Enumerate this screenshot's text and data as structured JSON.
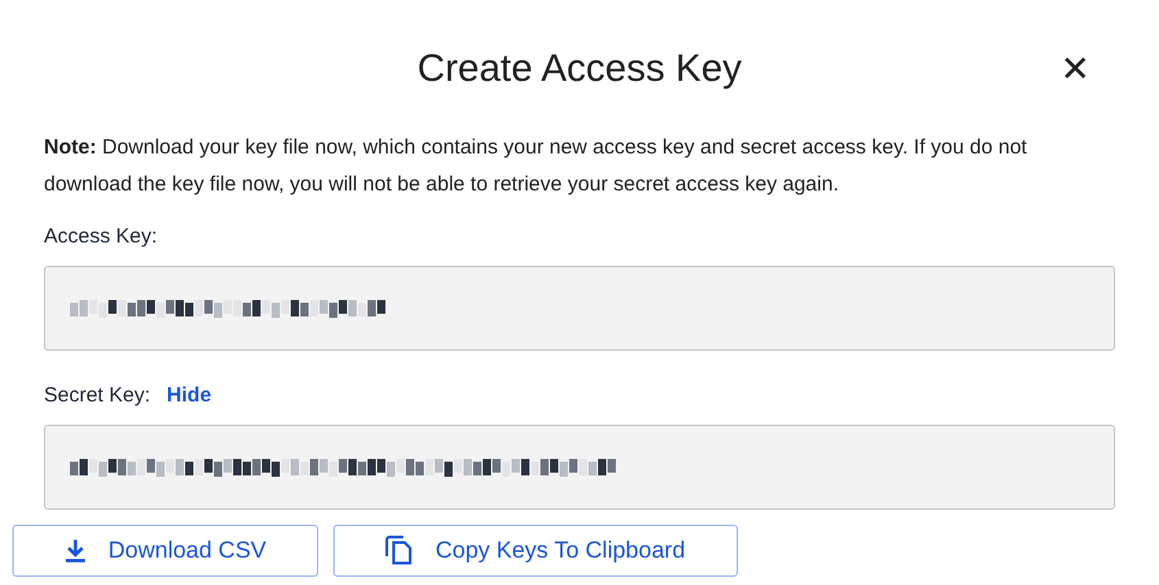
{
  "dialog": {
    "title": "Create Access Key",
    "close_label": "✕"
  },
  "note": "**Note:** Download your key file now, which contains your new access key and secret access key. If you do not download the key file now, you will not be able to retrieve your secret access key again.",
  "fields": [
    {
      "label": "Access Key:"
    },
    {
      "label": "Secret Key:",
      "link": "Hide"
    }
  ],
  "buttons": [
    {
      "kind": "download",
      "label": "Download CSV"
    },
    {
      "kind": "copy",
      "label": "Copy Keys To Clipboard"
    }
  ]
}
